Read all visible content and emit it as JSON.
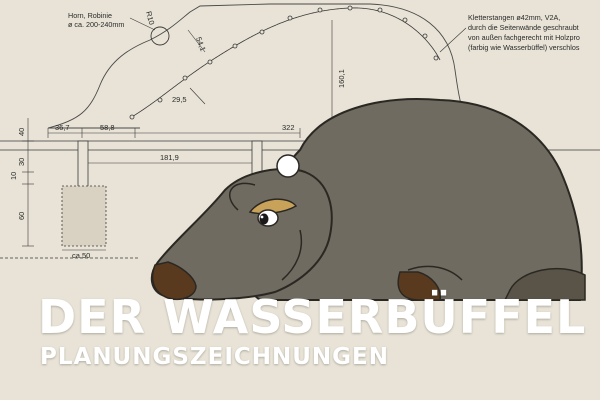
{
  "heading": {
    "title": "DER WASSERBÜFFEL",
    "subtitle": "PLANUNGSZEICHNUNGEN"
  },
  "drawing": {
    "horn_note": [
      "Horn, Robinie",
      "ø ca. 200-240mm"
    ],
    "climbing_note": [
      "Kletterstangen ø42mm, V2A,",
      "durch die Seitenwände geschraubt",
      "von außen fachgerecht mit Holzpro",
      "(farbig wie Wasserbüffel) verschlos"
    ],
    "dimensions": {
      "radius": "R10",
      "d_541": "54,1",
      "d_295": "29,5",
      "d_1601": "160,1",
      "d_367": "36,7",
      "d_588": "58,8",
      "d_322": "322",
      "d_1819": "181,9",
      "d_40": "40",
      "d_30": "30",
      "d_10": "10",
      "d_60": "60",
      "foundation": "ca.50"
    }
  },
  "colors": {
    "background": "#e8e3d6",
    "buffalo_body": "#6f6b60",
    "buffalo_outline": "#2b2824",
    "nose": "#5a3a1e",
    "horn": "#c9a25a",
    "title_text": "#ffffff",
    "line": "#3a3a3a"
  }
}
